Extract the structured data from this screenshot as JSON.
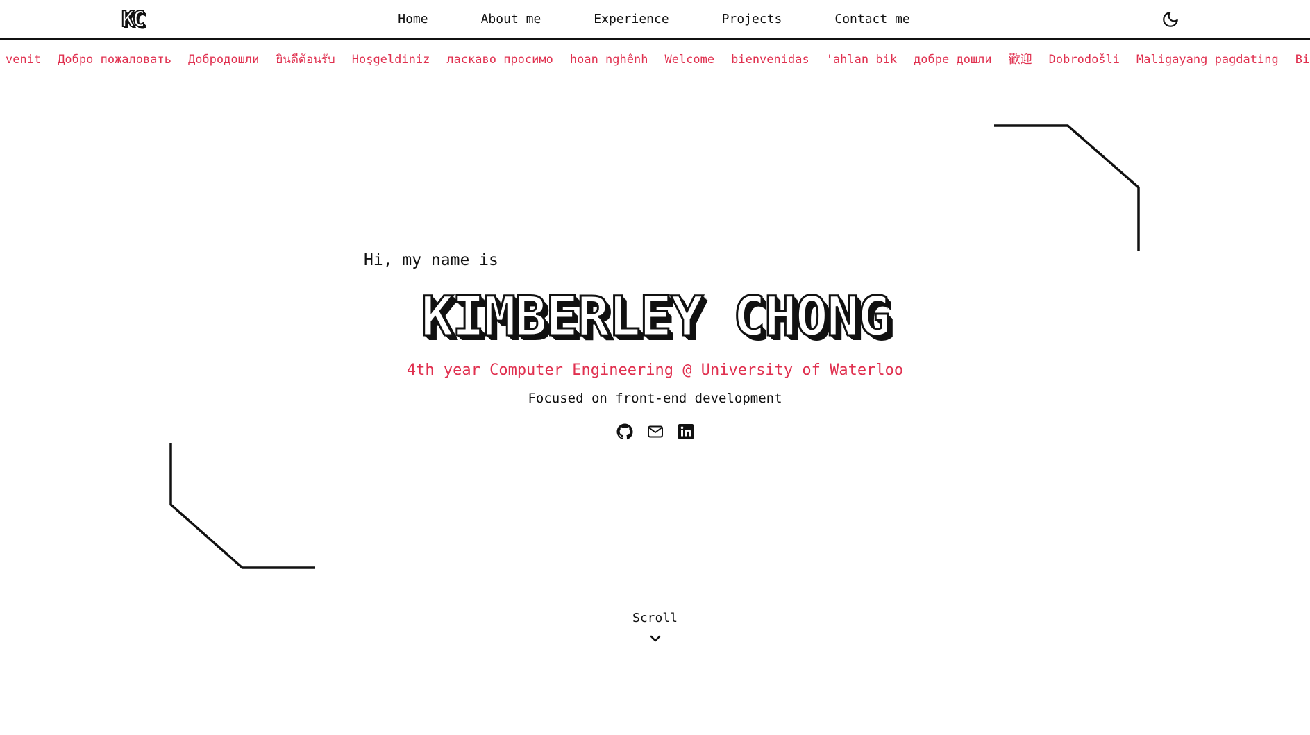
{
  "nav": {
    "logo": "KC",
    "links": [
      "Home",
      "About me",
      "Experience",
      "Projects",
      "Contact me"
    ],
    "theme_icon": "moon-icon"
  },
  "marquee": {
    "greetings": [
      "venit",
      "Добро пожаловать",
      "Добродошли",
      "ยินดีต้อนรับ",
      "Hoşgeldiniz",
      "ласкаво просимо",
      "hoan nghênh",
      "Welcome",
      "bienvenidas",
      "'ahlan bik",
      "добре дошли",
      "歡迎",
      "Dobrodošli",
      "Maligayang pagdating",
      "Bienvenue"
    ]
  },
  "hero": {
    "intro": "Hi, my name is",
    "name": "KIMBERLEY CHONG",
    "subtitle": "4th year Computer Engineering @ University of Waterloo",
    "focus": "Focused on front-end development",
    "socials": [
      "github-icon",
      "mail-icon",
      "linkedin-icon"
    ]
  },
  "scroll": {
    "label": "Scroll",
    "icon": "chevron-down-icon"
  },
  "colors": {
    "accent": "#e0304f",
    "text": "#111111",
    "background": "#ffffff"
  }
}
